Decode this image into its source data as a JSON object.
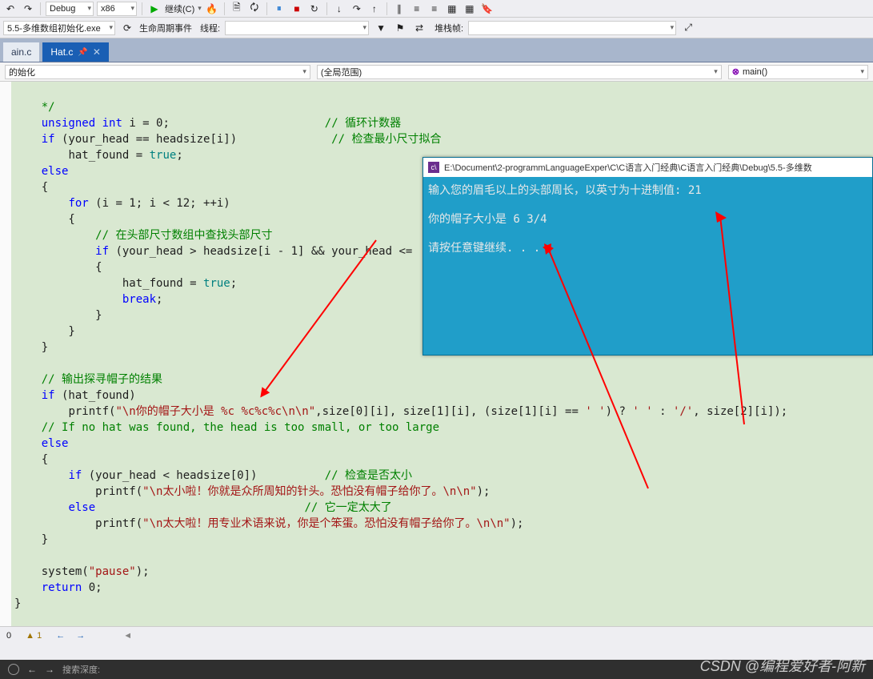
{
  "toolbar_top": {
    "config": "Debug",
    "platform": "x86",
    "continue_label": "继续(C)"
  },
  "toolbar_second": {
    "process_label": "5.5-多维数组初始化.exe",
    "lifecycle_label": "生命周期事件",
    "thread_label": "线程:",
    "stack_label": "堆栈帧:"
  },
  "tabs": [
    {
      "label": "ain.c",
      "active": false
    },
    {
      "label": "Hat.c",
      "active": true
    }
  ],
  "nav": {
    "left": "的始化",
    "middle": "(全局范围)",
    "right": "main()"
  },
  "console": {
    "title": "E:\\Document\\2-programmLanguageExper\\C\\C语言入门经典\\C语言入门经典\\Debug\\5.5-多维数",
    "line1_prefix": "输入您的眉毛以上的头部周长，以英寸为十进制值: ",
    "line1_input": "21",
    "line2": "你的帽子大小是 6 3/4",
    "line3": "请按任意键继续. . ."
  },
  "status": {
    "errors": "0",
    "warnings": "▲ 1"
  },
  "bottom": {
    "search_label": "搜索深度:"
  },
  "watermark": "CSDN @编程爱好者-阿新",
  "code": {
    "c_end": "*/",
    "l_unsigned": "unsigned",
    "l_int": "int",
    "l_i_decl": " i = 0;",
    "c_counter": "// 循环计数器",
    "l_if_head": "if",
    "l_if_cond": " (your_head == headsize[i])",
    "c_check_min": "// 检查最小尺寸拟合",
    "l_hat_found_true": "hat_found = ",
    "l_true": "true",
    "l_else": "else",
    "l_for": "for",
    "l_for_cond": " (i = 1; i < 12; ++i)",
    "c_find_headsize": "// 在头部尺寸数组中查找头部尺寸",
    "l_inner_if": " (your_head > headsize[i - 1] && your_head <=",
    "l_break": "break",
    "c_output_result": "// 输出探寻帽子的结果",
    "l_if_hatfound": " (hat_found)",
    "l_printf": "printf",
    "s_hat_fmt": "\"\\n你的帽子大小是 %c %c%c%c\\n\\n\"",
    "l_printf_tail": ",size[0][i], size[1][i], (size[1][i] == ",
    "s_space": "' '",
    "l_ternary_mid": ") ? ",
    "l_ternary_mid2": " : ",
    "s_slash": "'/'",
    "l_printf_end": ", size[2][i]);",
    "c_no_hat": "// If no hat was found, the head is too small, or too large",
    "l_if_small_cond": " (your_head < headsize[0])",
    "c_check_small": "// 检查是否太小",
    "s_too_small": "\"\\n太小啦！你就是众所周知的针头。恐怕没有帽子给你了。\\n\\n\"",
    "c_must_big": "// 它一定太大了",
    "s_too_big": "\"\\n太大啦！用专业术语来说，你是个笨蛋。恐怕没有帽子给你了。\\n\\n\"",
    "l_system": "system",
    "s_pause": "\"pause\"",
    "l_return": "return",
    "l_zero": " 0;"
  }
}
